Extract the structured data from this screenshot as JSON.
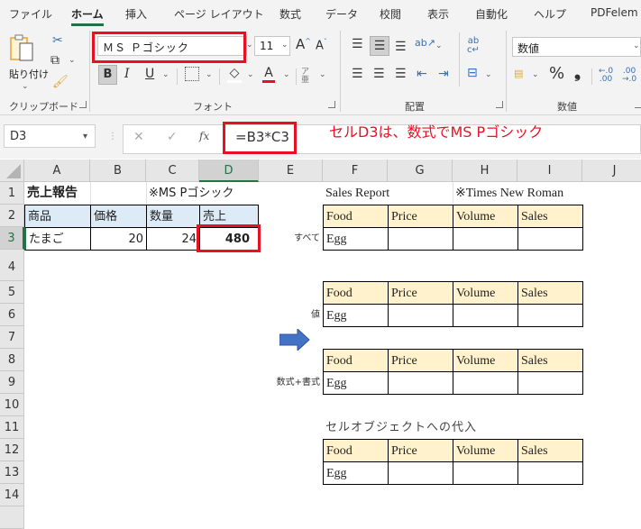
{
  "ribbon": {
    "tabs": [
      "ファイル",
      "ホーム",
      "挿入",
      "ページ レイアウト",
      "数式",
      "データ",
      "校閲",
      "表示",
      "自動化",
      "ヘルプ",
      "PDFelem"
    ],
    "active_tab": "ホーム",
    "clipboard": {
      "paste_label": "貼り付け",
      "group_label": "クリップボード"
    },
    "font": {
      "font_name": "ＭＳ Ｐゴシック",
      "font_size": "11",
      "bold": "B",
      "italic": "I",
      "underline": "U",
      "font_color_letter": "A",
      "grow": "A",
      "shrink": "A",
      "group_label": "フォント",
      "font_color": "#e81123"
    },
    "alignment": {
      "group_label": "配置",
      "wrap_label": "ab"
    },
    "number": {
      "format": "数値",
      "percent": "%",
      "comma": "9",
      "group_label": "数値"
    }
  },
  "formula_bar": {
    "name_box": "D3",
    "cancel": "✕",
    "enter": "✓",
    "fx": "fx",
    "formula": "=B3*C3",
    "annotation": "セルD3は、数式でMS Pゴシック"
  },
  "grid": {
    "columns": [
      "A",
      "B",
      "C",
      "D",
      "E",
      "F",
      "G",
      "H",
      "I",
      "J"
    ],
    "selected_column": "D",
    "rows": [
      "1",
      "2",
      "3",
      "4",
      "5",
      "6",
      "7",
      "8",
      "9",
      "10",
      "11",
      "12",
      "13",
      "14"
    ],
    "selected_row": "3"
  },
  "jp_table": {
    "title": "売上報告",
    "font_note": "※MS Pゴシック",
    "headers": [
      "商品",
      "価格",
      "数量",
      "売上"
    ],
    "row": [
      "たまご",
      "20",
      "24",
      "480"
    ]
  },
  "en_tables": {
    "title": "Sales Report",
    "font_note": "※Times New Roman",
    "headers": [
      "Food",
      "Price",
      "Volume",
      "Sales"
    ],
    "row": [
      "Egg",
      "",
      "",
      ""
    ],
    "labels": {
      "all": "すべて",
      "values": "値",
      "formula_format": "数式+書式"
    },
    "section_title": "セルオブジェクトへの代入"
  },
  "colors": {
    "highlight": "#e81123",
    "jp_header_fill": "#ddebf7",
    "en_header_fill": "#fff2cc",
    "arrow": "#4472c4",
    "accent": "#217346"
  }
}
